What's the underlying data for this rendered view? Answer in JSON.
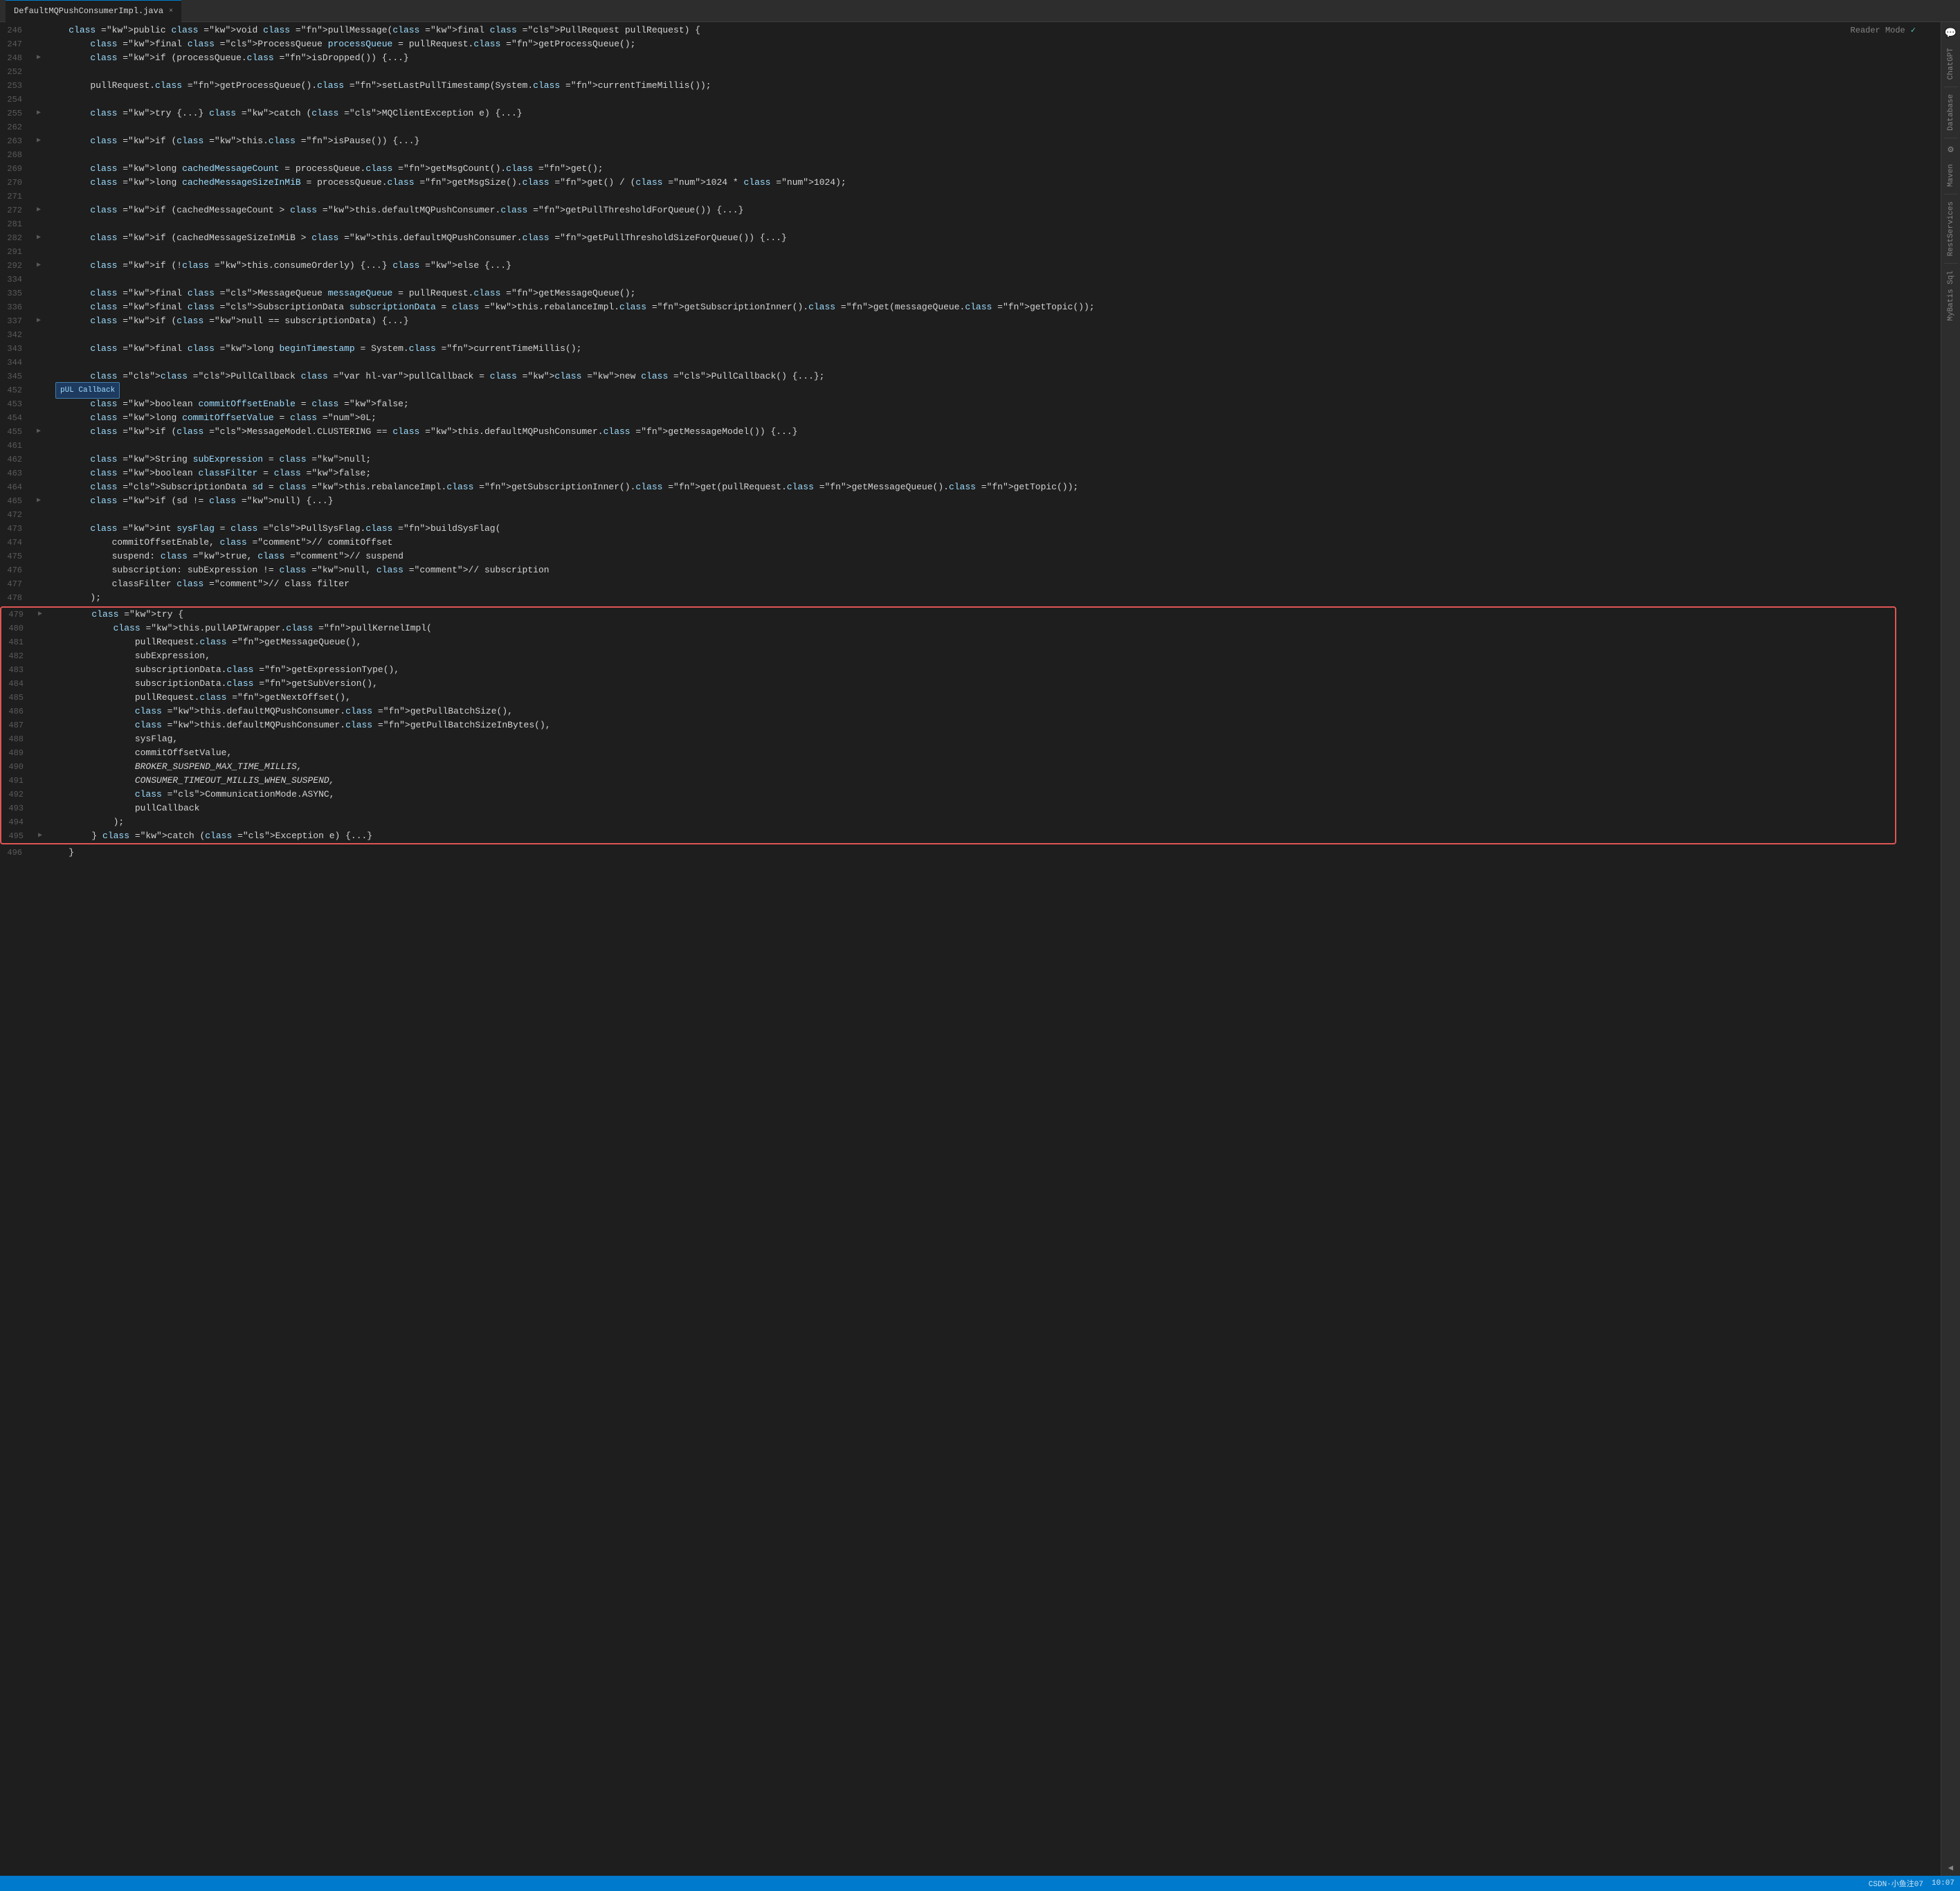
{
  "tab": {
    "filename": "DefaultMQPushConsumerImpl.java",
    "close_label": "×"
  },
  "reader_mode": {
    "label": "Reader Mode",
    "check": "✓"
  },
  "right_sidebar": {
    "items": [
      "ChatGPT",
      "Database",
      "Maven",
      "RestServices",
      "MyBatis Sql"
    ]
  },
  "status_bar": {
    "time": "10:07",
    "encoding": "CSDN·小鱼注07"
  },
  "annotation": {
    "text": "pUL Callback"
  },
  "code_lines": [
    {
      "num": "246",
      "fold": "",
      "content": "    public void pullMessage(final PullRequest pullRequest) {",
      "tokens": [
        {
          "t": "kw",
          "v": "    public "
        },
        {
          "t": "kw-void",
          "v": "void"
        },
        {
          "t": "",
          "v": " "
        },
        {
          "t": "fn",
          "v": "pullMessage"
        },
        {
          "t": "",
          "v": "("
        },
        {
          "t": "kw",
          "v": "final"
        },
        {
          "t": "",
          "v": " "
        },
        {
          "t": "cls",
          "v": "PullRequest"
        },
        {
          "t": "",
          "v": " "
        },
        {
          "t": "var",
          "v": "pullRequest"
        },
        {
          "t": "",
          "v": ") {"
        }
      ]
    },
    {
      "num": "247",
      "fold": "",
      "content": "        final ProcessQueue processQueue = pullRequest.getProcessQueue();"
    },
    {
      "num": "248",
      "fold": "▶",
      "content": "        if (processQueue.isDropped()) {...}"
    },
    {
      "num": "252",
      "fold": "",
      "content": ""
    },
    {
      "num": "253",
      "fold": "",
      "content": "        pullRequest.getProcessQueue().setLastPullTimestamp(System.currentTimeMillis());"
    },
    {
      "num": "254",
      "fold": "",
      "content": ""
    },
    {
      "num": "255",
      "fold": "▶",
      "content": "        try {...} catch (MQClientException e) {...}"
    },
    {
      "num": "262",
      "fold": "",
      "content": ""
    },
    {
      "num": "263",
      "fold": "▶",
      "content": "        if (this.isPause()) {...}"
    },
    {
      "num": "268",
      "fold": "",
      "content": ""
    },
    {
      "num": "269",
      "fold": "",
      "content": "        long cachedMessageCount = processQueue.getMsgCount().get();"
    },
    {
      "num": "270",
      "fold": "",
      "content": "        long cachedMessageSizeInMiB = processQueue.getMsgSize().get() / (1024 * 1024);"
    },
    {
      "num": "271",
      "fold": "",
      "content": ""
    },
    {
      "num": "272",
      "fold": "▶",
      "content": "        if (cachedMessageCount > this.defaultMQPushConsumer.getPullThresholdForQueue()) {...}"
    },
    {
      "num": "281",
      "fold": "",
      "content": ""
    },
    {
      "num": "282",
      "fold": "▶",
      "content": "        if (cachedMessageSizeInMiB > this.defaultMQPushConsumer.getPullThresholdSizeForQueue()) {...}"
    },
    {
      "num": "291",
      "fold": "",
      "content": ""
    },
    {
      "num": "292",
      "fold": "▶",
      "content": "        if (!this.consumeOrderly) {...} else {...}"
    },
    {
      "num": "334",
      "fold": "",
      "content": ""
    },
    {
      "num": "335",
      "fold": "",
      "content": "        final MessageQueue messageQueue = pullRequest.getMessageQueue();"
    },
    {
      "num": "336",
      "fold": "",
      "content": "        final SubscriptionData subscriptionData = this.rebalanceImpl.getSubscriptionInner().get(messageQueue.getTopic());"
    },
    {
      "num": "337",
      "fold": "▶",
      "content": "        if (null == subscriptionData) {...}"
    },
    {
      "num": "342",
      "fold": "",
      "content": ""
    },
    {
      "num": "343",
      "fold": "",
      "content": "        final long beginTimestamp = System.currentTimeMillis();"
    },
    {
      "num": "344",
      "fold": "",
      "content": ""
    },
    {
      "num": "345",
      "fold": "",
      "content": "        PullCallback pullCallback = new PullCallback() {...};",
      "highlight_var": true
    },
    {
      "num": "452",
      "fold": "",
      "content": ""
    },
    {
      "num": "453",
      "fold": "",
      "content": "        boolean commitOffsetEnable = false;"
    },
    {
      "num": "454",
      "fold": "",
      "content": "        long commitOffsetValue = 0L;"
    },
    {
      "num": "455",
      "fold": "▶",
      "content": "        if (MessageModel.CLUSTERING == this.defaultMQPushConsumer.getMessageModel()) {...}"
    },
    {
      "num": "461",
      "fold": "",
      "content": ""
    },
    {
      "num": "462",
      "fold": "",
      "content": "        String subExpression = null;"
    },
    {
      "num": "463",
      "fold": "",
      "content": "        boolean classFilter = false;"
    },
    {
      "num": "464",
      "fold": "",
      "content": "        SubscriptionData sd = this.rebalanceImpl.getSubscriptionInner().get(pullRequest.getMessageQueue().getTopic());"
    },
    {
      "num": "465",
      "fold": "▶",
      "content": "        if (sd != null) {...}"
    },
    {
      "num": "472",
      "fold": "",
      "content": ""
    },
    {
      "num": "473",
      "fold": "",
      "content": "        int sysFlag = PullSysFlag.buildSysFlag("
    },
    {
      "num": "474",
      "fold": "",
      "content": "            commitOffsetEnable, // commitOffset"
    },
    {
      "num": "475",
      "fold": "",
      "content": "            suspend: true, // suspend",
      "italic_parts": [
        {
          "start": 12,
          "end": 19
        }
      ]
    },
    {
      "num": "476",
      "fold": "",
      "content": "            subscription: subExpression != null, // subscription"
    },
    {
      "num": "477",
      "fold": "",
      "content": "            classFilter // class filter"
    },
    {
      "num": "478",
      "fold": "",
      "content": "        );"
    },
    {
      "num": "479",
      "fold": "▶",
      "content": "        try {",
      "is_try_start": true
    },
    {
      "num": "480",
      "fold": "",
      "content": "            this.pullAPIWrapper.pullKernelImpl("
    },
    {
      "num": "481",
      "fold": "",
      "content": "                pullRequest.getMessageQueue(),"
    },
    {
      "num": "482",
      "fold": "",
      "content": "                subExpression,"
    },
    {
      "num": "483",
      "fold": "",
      "content": "                subscriptionData.getExpressionType(),"
    },
    {
      "num": "484",
      "fold": "",
      "content": "                subscriptionData.getSubVersion(),"
    },
    {
      "num": "485",
      "fold": "",
      "content": "                pullRequest.getNextOffset(),"
    },
    {
      "num": "486",
      "fold": "",
      "content": "                this.defaultMQPushConsumer.getPullBatchSize(),"
    },
    {
      "num": "487",
      "fold": "",
      "content": "                this.defaultMQPushConsumer.getPullBatchSizeInBytes(),"
    },
    {
      "num": "488",
      "fold": "",
      "content": "                sysFlag,"
    },
    {
      "num": "489",
      "fold": "",
      "content": "                commitOffsetValue,"
    },
    {
      "num": "490",
      "fold": "",
      "content": "                BROKER_SUSPEND_MAX_TIME_MILLIS,",
      "italic": true
    },
    {
      "num": "491",
      "fold": "",
      "content": "                CONSUMER_TIMEOUT_MILLIS_WHEN_SUSPEND,",
      "italic": true
    },
    {
      "num": "492",
      "fold": "",
      "content": "                CommunicationMode.ASYNC,"
    },
    {
      "num": "493",
      "fold": "",
      "content": "                pullCallback"
    },
    {
      "num": "494",
      "fold": "",
      "content": "            );"
    },
    {
      "num": "495",
      "fold": "▶",
      "content": "        } catch (Exception e) {...}"
    },
    {
      "num": "496",
      "fold": "",
      "content": "    }"
    }
  ]
}
